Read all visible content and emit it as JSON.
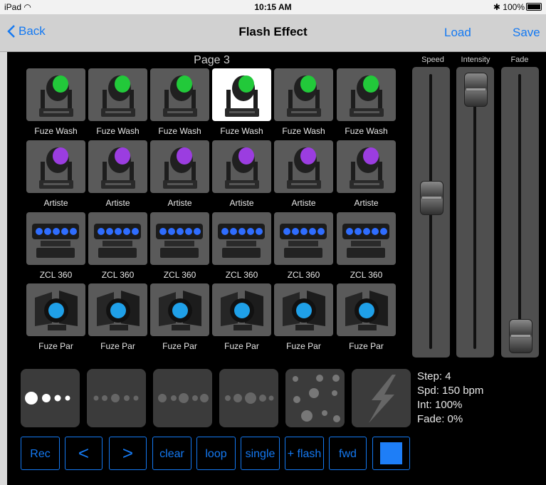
{
  "status": {
    "device": "iPad",
    "time": "10:15 AM",
    "battery": "100%"
  },
  "nav": {
    "back": "Back",
    "title": "Flash Effect",
    "load": "Load",
    "save": "Save"
  },
  "page_label": "Page 3",
  "fixtures": {
    "row1": {
      "name": "Fuze Wash",
      "selected_index": 3
    },
    "row2": {
      "name": "Artiste"
    },
    "row3": {
      "name": "ZCL 360"
    },
    "row4": {
      "name": "Fuze Par"
    }
  },
  "sliders": {
    "speed": {
      "label": "Speed",
      "level": 0.56
    },
    "intensity": {
      "label": "Intensity",
      "level": 1.0
    },
    "fade": {
      "label": "Fade",
      "level": 0.0
    }
  },
  "patterns": [
    "large-to-small-dots",
    "even-small-dots",
    "alternating-dots",
    "growing-dots",
    "scattered-dots",
    "lightning-bolt"
  ],
  "selected_pattern": 0,
  "info": {
    "step": "Step: 4",
    "speed": "Spd: 150 bpm",
    "intensity": "Int: 100%",
    "fade": "Fade: 0%"
  },
  "buttons": {
    "rec": "Rec",
    "prev": "<",
    "next": ">",
    "clear": "clear",
    "loop": "loop",
    "single": "single",
    "flash": "+ flash",
    "fwd": "fwd"
  },
  "colors": {
    "accent": "#1479f2",
    "wash_lens": "#22c93a",
    "artiste_lens": "#9b3de0",
    "zcl_lens": "#2f6dff",
    "par_lens": "#1fa0e8",
    "stop_square": "#1e7ef7"
  }
}
